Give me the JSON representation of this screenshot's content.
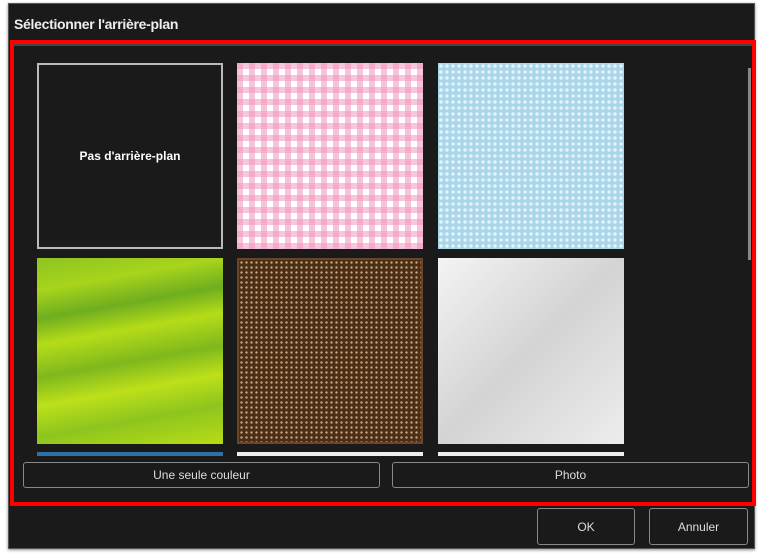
{
  "dialog": {
    "title": "Sélectionner l'arrière-plan"
  },
  "backgrounds": {
    "none_label": "Pas d'arrière-plan",
    "items": [
      "none",
      "pink-gingham",
      "blue-dots",
      "green-waves",
      "brown-dots",
      "silver-metal"
    ]
  },
  "buttons": {
    "single_color": "Une seule couleur",
    "photo": "Photo",
    "ok": "OK",
    "cancel": "Annuler"
  },
  "colors": {
    "highlight": "#ff0000"
  }
}
